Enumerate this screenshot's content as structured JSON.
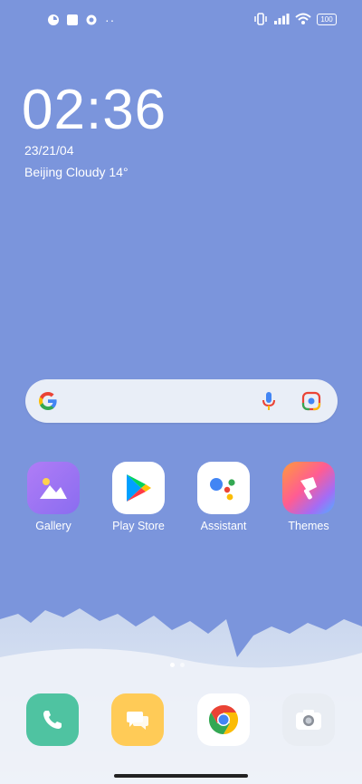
{
  "status_bar": {
    "left_icons": [
      "app-notification-icon",
      "stop-icon",
      "settings-icon",
      "more-dots-icon"
    ],
    "more_text": "··",
    "right_icons": [
      "vibrate-icon",
      "signal-icon",
      "wifi-icon",
      "battery-icon"
    ],
    "battery_level": "100"
  },
  "clock": {
    "time": "02:36",
    "date": "23/21/04",
    "weather": "Beijing Cloudy 14°"
  },
  "search_bar": {
    "logo_icon": "google-g-icon",
    "voice_icon": "microphone-icon",
    "camera_icon": "google-lens-icon"
  },
  "home_apps": [
    {
      "label": "Gallery",
      "icon": "gallery-icon"
    },
    {
      "label": "Play Store",
      "icon": "play-store-icon"
    },
    {
      "label": "Assistant",
      "icon": "assistant-icon"
    },
    {
      "label": "Themes",
      "icon": "themes-icon"
    }
  ],
  "page_indicator": {
    "pages": 2,
    "active": 0
  },
  "dock": [
    {
      "icon": "phone-icon"
    },
    {
      "icon": "messages-icon"
    },
    {
      "icon": "chrome-icon"
    },
    {
      "icon": "camera-icon"
    }
  ]
}
